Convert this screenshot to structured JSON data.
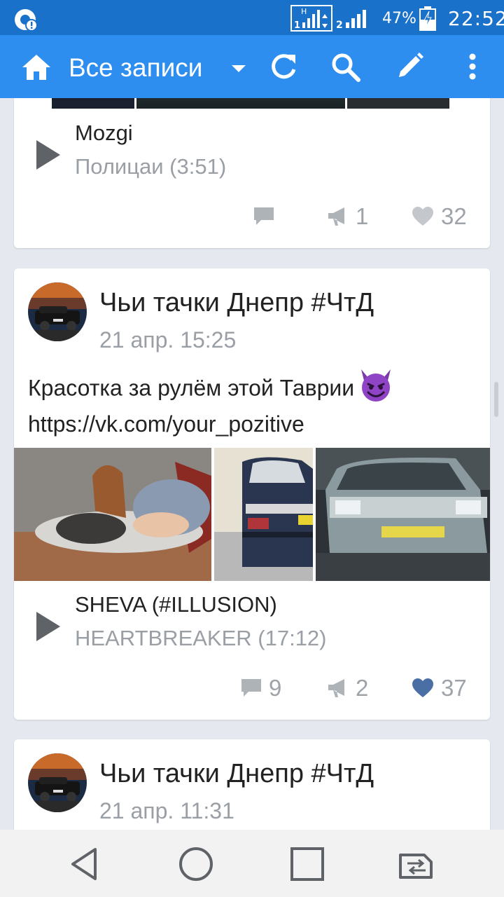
{
  "status_bar": {
    "battery_percent": "47%",
    "time": "22:52"
  },
  "toolbar": {
    "title": "Все записи"
  },
  "posts": [
    {
      "audio": {
        "artist": "Mozgi",
        "track": "Полицаи (3:51)"
      },
      "actions": {
        "comments": "",
        "reposts": "1",
        "likes": "32"
      }
    },
    {
      "author": "Чьи тачки Днепр #ЧтД",
      "date": "21 апр. 15:25",
      "text_line1": "Красотка за рулём этой Таврии",
      "text_line2": "https://vk.com/your_pozitive",
      "audio": {
        "artist": "SHEVA (#ILLUSION)",
        "track": "HEARTBREAKER (17:12)"
      },
      "actions": {
        "comments": "9",
        "reposts": "2",
        "likes": "37"
      }
    },
    {
      "author": "Чьи тачки Днепр #ЧтД",
      "date": "21 апр. 11:31"
    }
  ],
  "colors": {
    "status_bar": "#1a71c9",
    "toolbar": "#2d8ef0",
    "background": "#e5e9ef",
    "liked_heart": "#4a6fa5",
    "muted": "#9ea3a9"
  }
}
